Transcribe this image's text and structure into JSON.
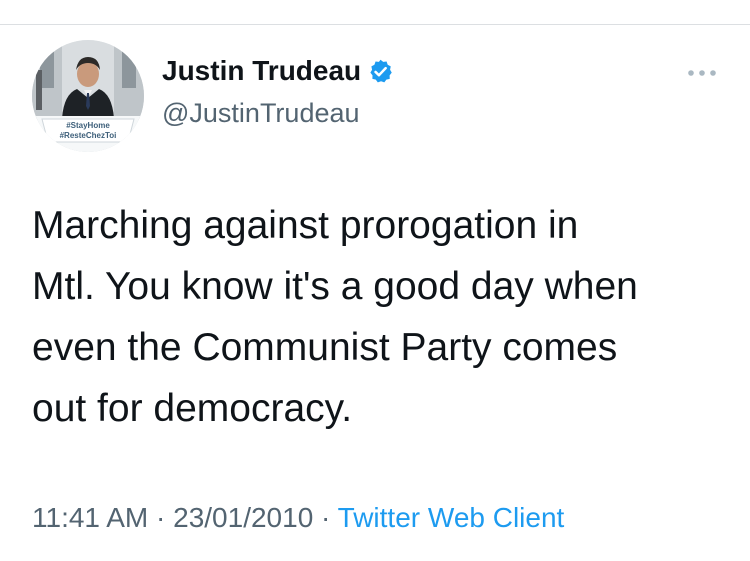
{
  "tweet": {
    "author": {
      "display_name": "Justin Trudeau",
      "handle": "@JustinTrudeau",
      "verified": true,
      "avatar_badge_lines": [
        "#StayHome",
        "#ResteChezToi"
      ]
    },
    "text": "Marching against prorogation in\nMtl. You know it's a good day when\neven the Communist Party comes\nout for democracy.",
    "time": "11:41 AM",
    "date": "23/01/2010",
    "source": "Twitter Web Client",
    "separator": " · "
  },
  "icons": {
    "verified": "verified-badge-icon",
    "more": "more-dots-icon"
  },
  "colors": {
    "accent": "#1d9bf0",
    "secondary_text": "#536471",
    "primary_text": "#0f1419"
  }
}
